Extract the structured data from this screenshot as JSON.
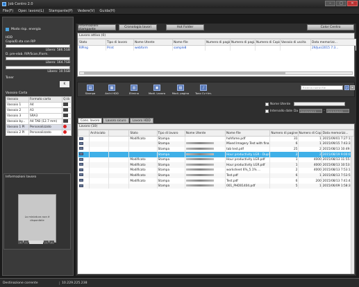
{
  "window": {
    "title": "Job Centro 2.0"
  },
  "menu": [
    "File(F)",
    "Oper. lavoro(L)",
    "Stampante(P)",
    "Vedere(V)",
    "Guida(H)"
  ],
  "left": {
    "power_mode": "Modo risp. energia",
    "hdd_label": "HDD",
    "hdd_copy_label": "Copia/D.sta con RIP",
    "hdd_copy_free": "Libero: 586.5GB",
    "hdd_pre_label": "D. pre-elab. RIP/Scan./Form.",
    "hdd_pre_free": "Libero: 164.7GB",
    "hdd_pre_free2": "Libero: 10.5GB",
    "toner_label": "Toner",
    "toner_value": "K",
    "tray_header": "Vassoio Carta",
    "tray_columns": [
      "Vassoio",
      "Formato carta",
      "Q.tà"
    ],
    "trays": [
      {
        "name": "Vassoio 1",
        "format": "A4",
        "status": "ok"
      },
      {
        "name": "Vassoio 2",
        "format": "A3",
        "status": "ok"
      },
      {
        "name": "Vassoio 3",
        "format": "SRA3",
        "status": "ok"
      },
      {
        "name": "Vassoio by...",
        "format": "A4 TAB (12.7 mm)",
        "status": "ok"
      },
      {
        "name": "Vassoio 1 PI",
        "format": "Personalizzato",
        "status": "err"
      },
      {
        "name": "Vassoio 2 PI",
        "format": "Personalizzato",
        "status": "err"
      }
    ],
    "job_info_title": "Informazioni lavoro",
    "thumb_text": "La miniatura non è disponibile"
  },
  "topbuttons": {
    "printer_info": "Informazioni stampante",
    "job_history": "Cronologia lavori",
    "hot_folder": "Hot Folder",
    "color_centro": "Color Centro"
  },
  "active_jobs": {
    "title": "Lavoro attivo (0)",
    "columns": [
      "Stato",
      "Tipo di lavoro",
      "Nome Utente",
      "Nome file",
      "Numero di pagine",
      "Numero di pagi...",
      "Numero di Copie",
      "Vassoio di uscita",
      "Data memorizz..."
    ],
    "rows": [
      [
        "RIPing",
        "Print",
        "webform",
        "sample8",
        "",
        "",
        "",
        "",
        "29/Jun/2015 7:3..."
      ]
    ]
  },
  "toolbar": {
    "tools": [
      "Stampa",
      "Archi HDD",
      "Elimina",
      "Modi. Lavoro",
      "Modi. pagina",
      "Tono Cv+Im."
    ],
    "search_placeholder": "Ricerca nome file"
  },
  "filters": {
    "user_name": "Nome Utente",
    "date_interval": "Intervallo date",
    "from_label": "Da",
    "from_date": "2015/10/13",
    "to_date": "2015/10/13"
  },
  "tabs": [
    "Cons. lavoro",
    "Lavoro sicuro",
    "Lavoro HDD"
  ],
  "job_list": {
    "title": "Lavoro (10)",
    "columns": [
      "",
      "Archiviato",
      "",
      "Stato",
      "Tipo di lavoro",
      "Nome Utente",
      "Nome file",
      "Numero di pagine",
      "Numero di Copie",
      "Data memorizz..."
    ],
    "rows": [
      {
        "icon": "doc",
        "stato": "Modificato",
        "tipo": "Stampa",
        "user_blur": false,
        "file": "hohfome.pdf",
        "pages": "31",
        "copies": "1",
        "date": "2015/09/01 7:27:1...",
        "sel": false
      },
      {
        "icon": "doc",
        "stato": "",
        "tipo": "Stampa",
        "user_blur": true,
        "file": "Mixed Imagery Test with final ...",
        "pages": "6",
        "copies": "1",
        "date": "2015/09/15 7:43:3...",
        "sel": false
      },
      {
        "icon": "doc",
        "stato": "",
        "tipo": "Stampa",
        "user_blur": true,
        "file": "tab test.pdf",
        "pages": "25",
        "copies": "2",
        "date": "2015/08/13 10:49:...",
        "sel": false
      },
      {
        "icon": "doc",
        "stato": "",
        "tipo": "Stampa",
        "user_blur": true,
        "file": "Hour productivity LGR - Duple...",
        "pages": "2",
        "copies": "2",
        "date": "2015/08/19 9:00:0...",
        "sel": true
      },
      {
        "icon": "stack",
        "stato": "Modificato",
        "tipo": "Stampa",
        "user_blur": true,
        "file": "Hour productivity LGR.pdf",
        "pages": "1",
        "copies": "4000",
        "date": "2015/08/13 11:55:...",
        "sel": false
      },
      {
        "icon": "stack",
        "stato": "Modificato",
        "tipo": "Stampa",
        "user_blur": true,
        "file": "Hour productivity LGR.pdf",
        "pages": "1",
        "copies": "4000",
        "date": "2015/08/13 10:53:...",
        "sel": false
      },
      {
        "icon": "doc",
        "stato": "Modificato",
        "tipo": "Stampa",
        "user_blur": true,
        "file": "worksheet 6%_5.1% ...",
        "pages": "2",
        "copies": "4000",
        "date": "2015/08/13 7:53:1...",
        "sel": false
      },
      {
        "icon": "doc",
        "stato": "Modificato",
        "tipo": "Stampa",
        "user_blur": true,
        "file": "Test.pdf",
        "pages": "6",
        "copies": "1",
        "date": "2015/08/13 7:53:5...",
        "sel": false
      },
      {
        "icon": "stack",
        "stato": "Modificato",
        "tipo": "Stampa",
        "user_blur": true,
        "file": "Test.pdf",
        "pages": "6",
        "copies": "200",
        "date": "2015/08/13 7:41:4...",
        "sel": false
      },
      {
        "icon": "stack",
        "stato": "",
        "tipo": "Stampa",
        "user_blur": true,
        "file": "001_PHD01404.pdf",
        "pages": "5",
        "copies": "1",
        "date": "2015/06/09 1:58:3...",
        "sel": false
      }
    ]
  },
  "status": {
    "dest_label": "Destinazione corrente",
    "ip": "10.229.225.238"
  }
}
